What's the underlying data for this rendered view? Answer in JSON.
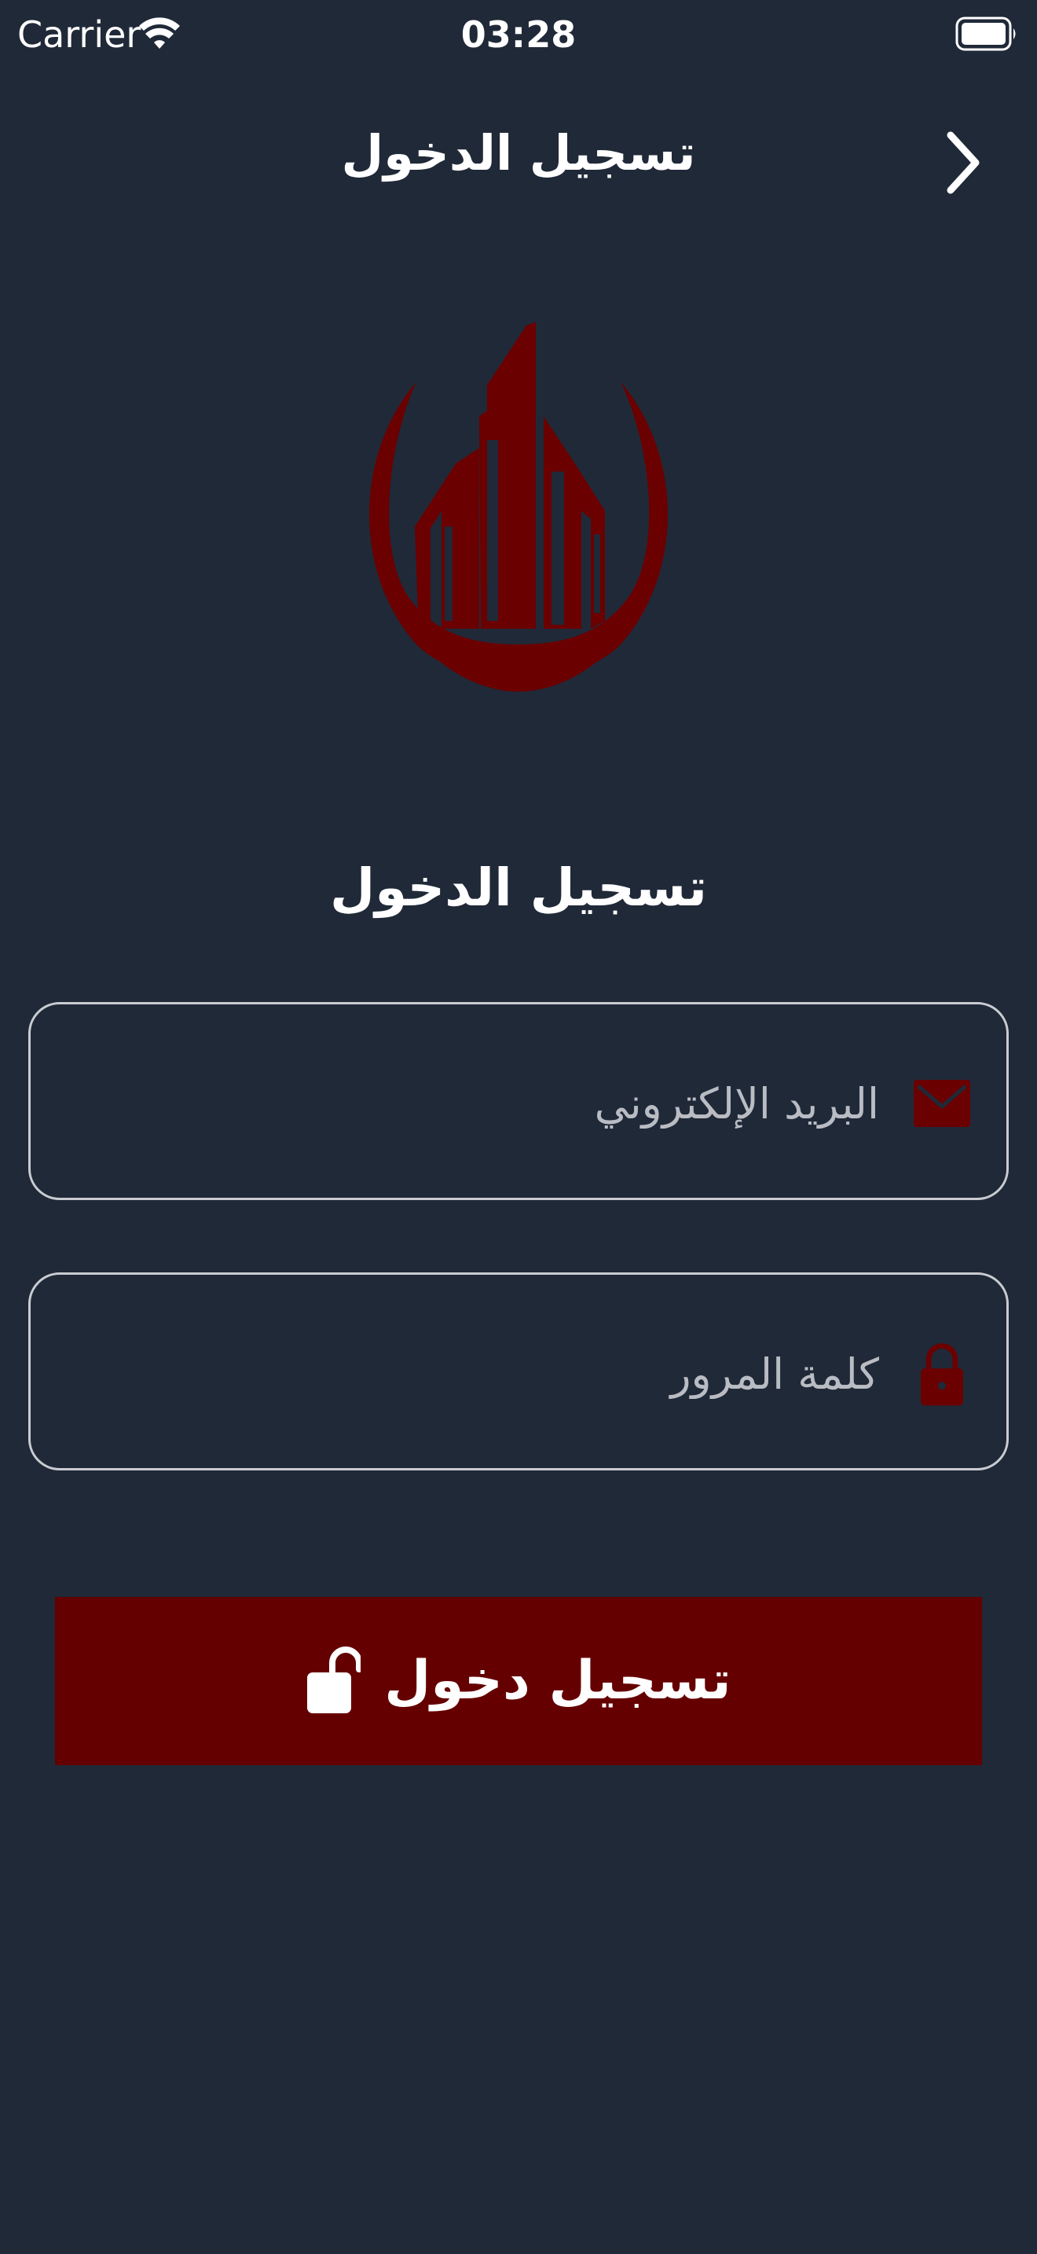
{
  "status_bar": {
    "carrier": "Carrier",
    "time": "03:28"
  },
  "nav": {
    "title": "تسجيل الدخول",
    "back_icon": "chevron-right-icon"
  },
  "logo": {
    "name": "buildings-logo",
    "color": "#6b0000"
  },
  "form": {
    "heading": "تسجيل الدخول",
    "email": {
      "placeholder": "البريد الإلكتروني",
      "value": "",
      "icon": "envelope-icon"
    },
    "password": {
      "placeholder": "كلمة المرور",
      "value": "",
      "icon": "lock-icon"
    },
    "submit": {
      "label": "تسجيل دخول",
      "icon": "unlock-icon"
    }
  },
  "colors": {
    "background": "#202938",
    "accent": "#650000",
    "field_border": "#c9ccd2",
    "placeholder": "#b9bcc3"
  }
}
